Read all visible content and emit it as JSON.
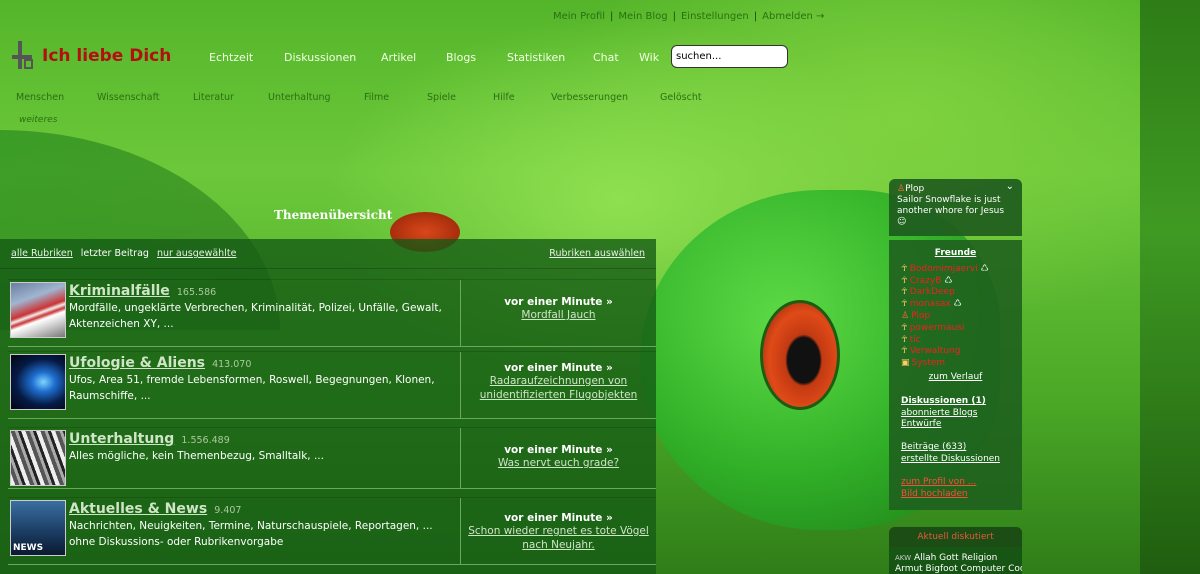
{
  "top_links": [
    "Mein Profil",
    "Mein Blog",
    "Einstellungen",
    "Abmelden →"
  ],
  "logo": {
    "text": "Ich liebe Dich"
  },
  "nav": [
    "Echtzeit",
    "Diskussionen",
    "Artikel",
    "Blogs",
    "Statistiken",
    "Chat",
    "Wik"
  ],
  "search": {
    "value": "suchen..."
  },
  "subnav": [
    "Menschen",
    "Wissenschaft",
    "Literatur",
    "Unterhaltung",
    "Filme",
    "Spiele",
    "Hilfe",
    "Verbesserungen",
    "Gelöscht"
  ],
  "subnav_more": "weiteres",
  "page_title": "Themenübersicht",
  "filter": {
    "all": "alle Rubriken",
    "last": "letzter Beitrag",
    "selected": "nur ausgewählte",
    "choose": "Rubriken auswählen"
  },
  "categories": [
    {
      "name": "Kriminalfälle",
      "count": "165.586",
      "desc": "Mordfälle, ungeklärte Verbrechen, Kriminalität, Polizei, Unfälle, Gewalt, Aktenzeichen XY, ...",
      "time": "vor einer Minute »",
      "topic": "Mordfall Jauch"
    },
    {
      "name": "Ufologie & Aliens",
      "count": "413.070",
      "desc": "Ufos, Area 51, fremde Lebensformen, Roswell, Begegnungen, Klonen, Raumschiffe, ...",
      "time": "vor einer Minute »",
      "topic": "Radaraufzeichnungen von unidentifizierten Flugobjekten"
    },
    {
      "name": "Unterhaltung",
      "count": "1.556.489",
      "desc": "Alles mögliche, kein Themenbezug, Smalltalk, ...",
      "time": "vor einer Minute »",
      "topic": "Was nervt euch grade?"
    },
    {
      "name": "Aktuelles & News",
      "count": "9.407",
      "desc": "Nachrichten, Neuigkeiten, Termine, Naturschauspiele, Reportagen, ... ohne Diskussions- oder Rubrikenvorgabe",
      "time": "vor einer Minute »",
      "topic": "Schon wieder regnet es tote Vögel nach Neujahr.",
      "thumb_label": "NEWS"
    }
  ],
  "status_box": {
    "user": "Plop",
    "text": "Sailor Snowflake is just another whore for Jesus ☺"
  },
  "sidebar": {
    "friends_title": "Freunde",
    "friends": [
      "Bodomimjaervi",
      "CrazyB",
      "DarkDeep",
      "monasax",
      "Plop",
      "powermausi",
      "tic",
      "Verwaltung",
      "System"
    ],
    "history": "zum Verlauf",
    "discussions": "Diskussionen (1)",
    "subscribed": "abonnierte Blogs",
    "drafts": "Entwürfe",
    "posts": "Beiträge (633)",
    "created": "erstellte Diskussionen",
    "profile": "zum Profil von ...",
    "upload": "Bild hochladen"
  },
  "aktuell": {
    "title": "Aktuell diskutiert",
    "line1_small": "AKW",
    "line1": "Allah Gott Religion",
    "line2": "Armut  Bigfoot  Computer  Cool"
  }
}
